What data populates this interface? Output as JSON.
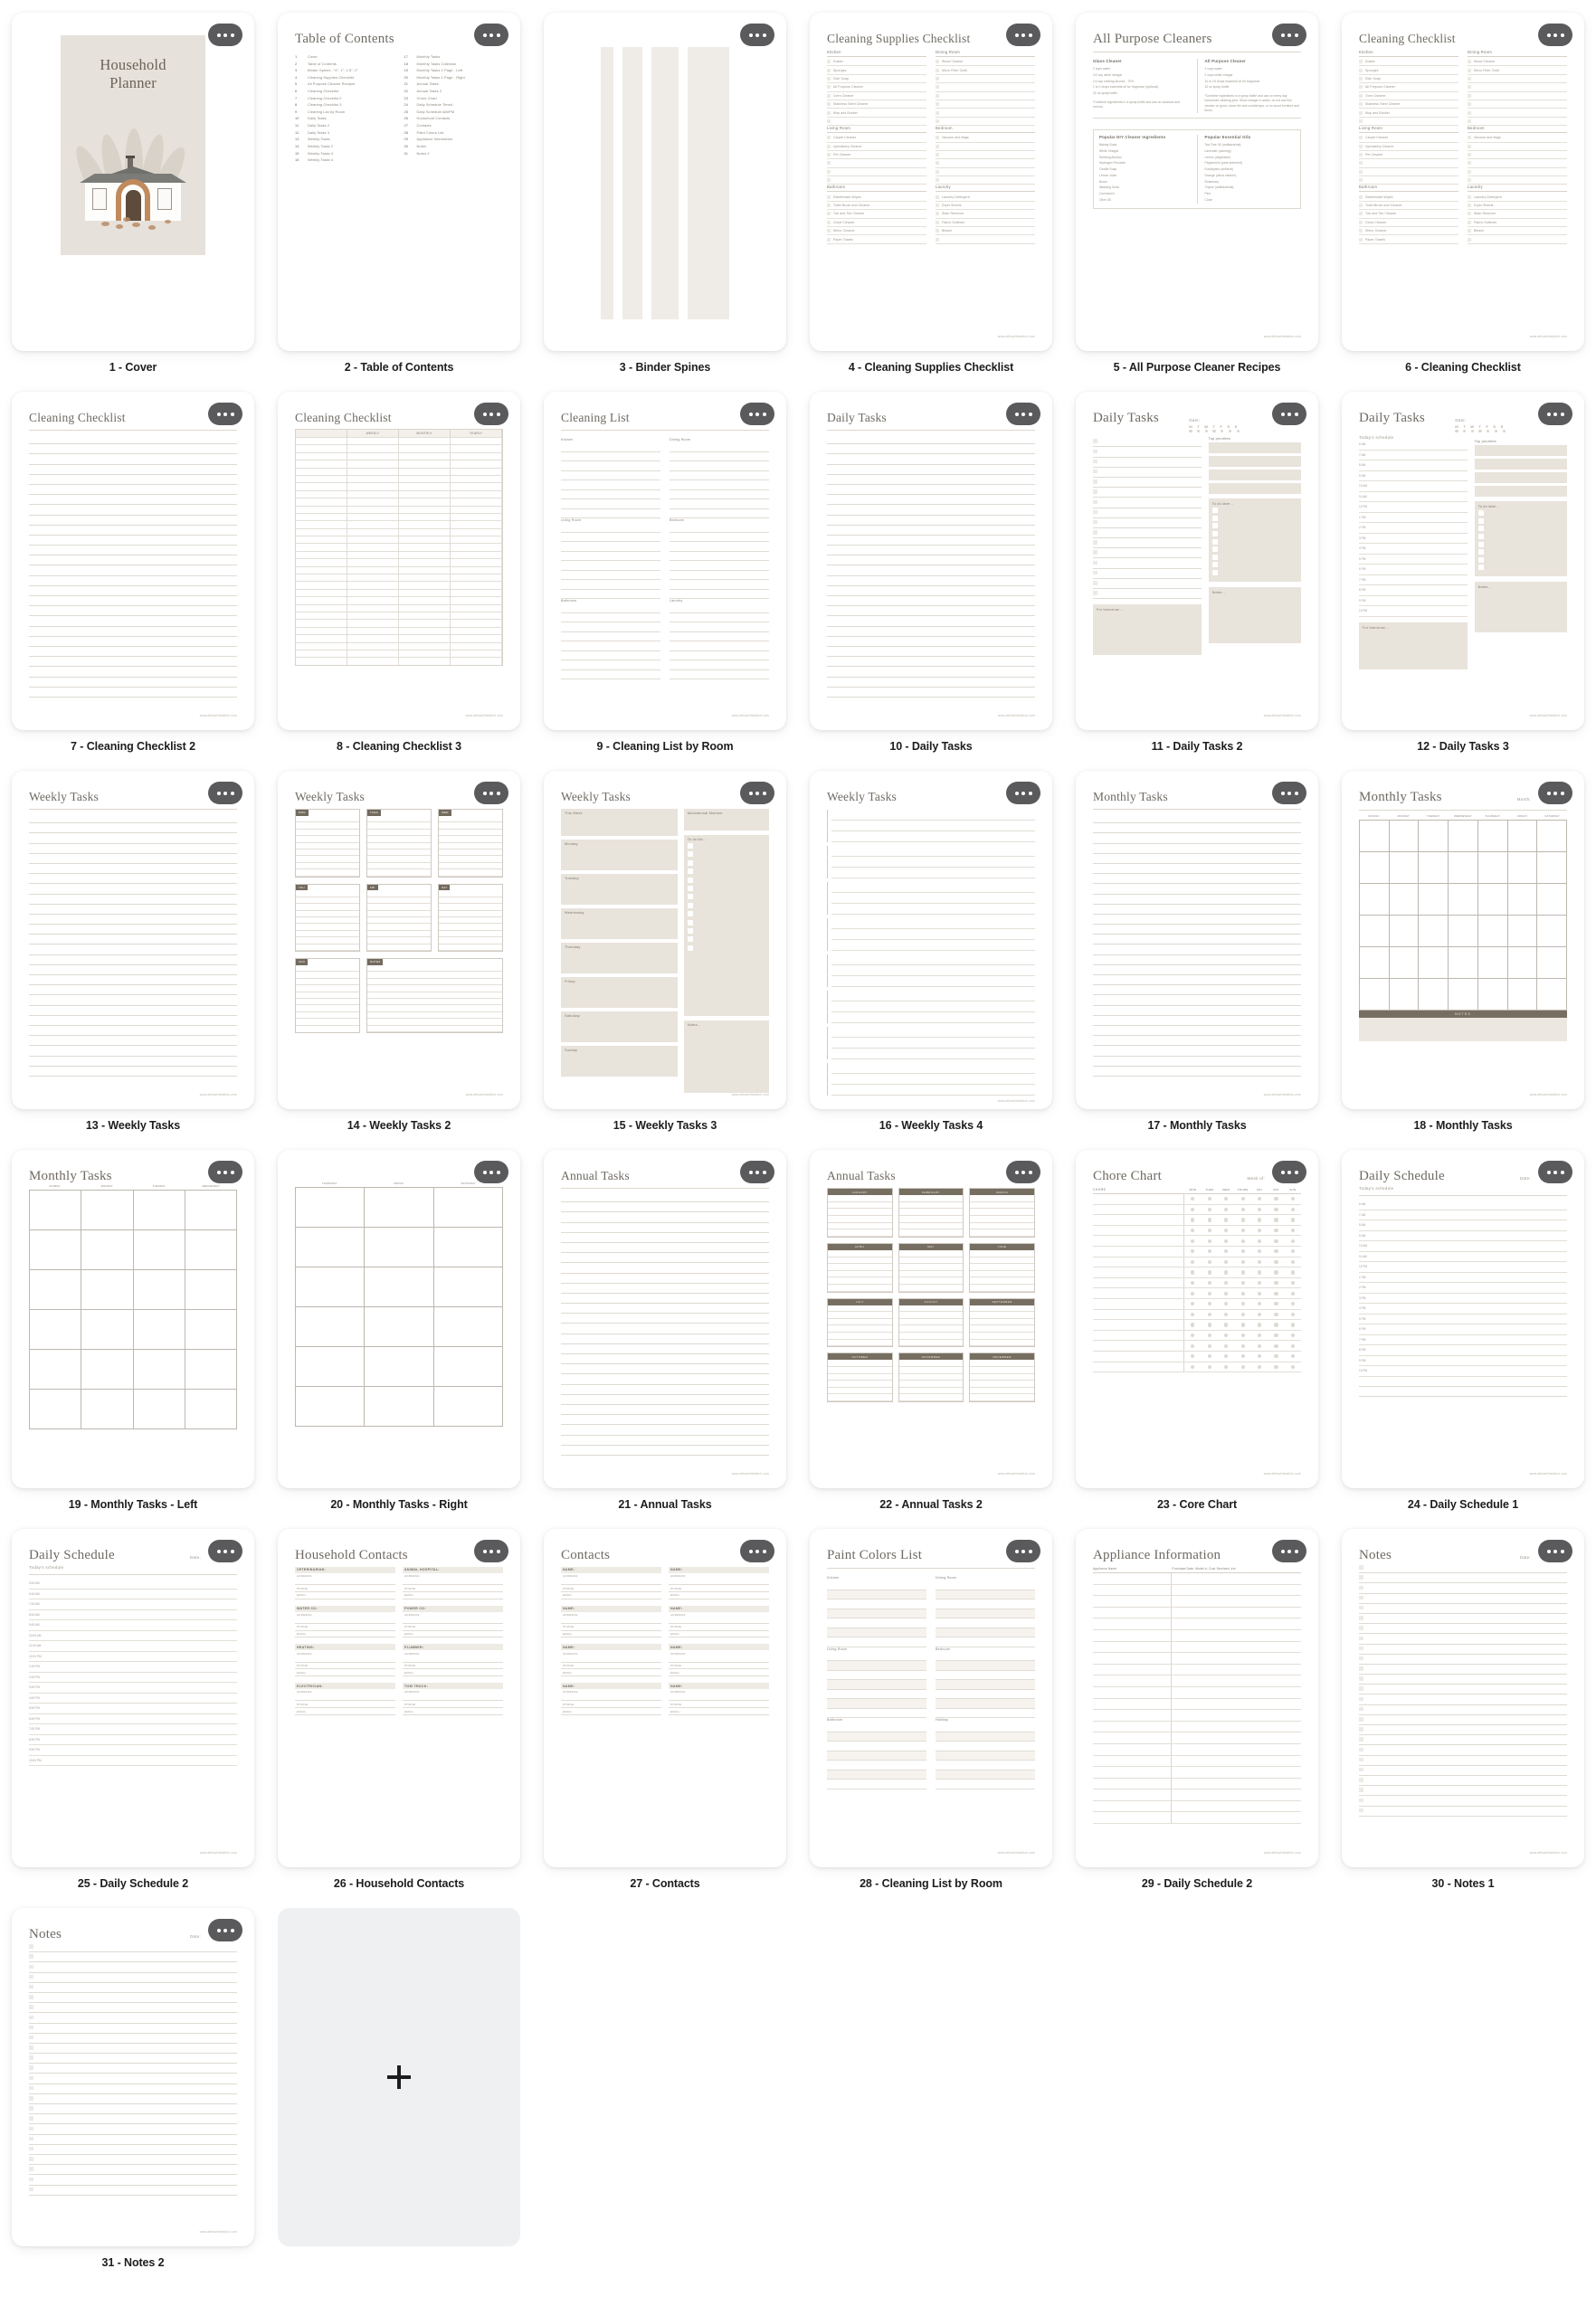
{
  "app": {
    "background_color": "#ffffff",
    "card_background": "#ffffff",
    "accent_brown": "#776e62",
    "shade_beige": "#e8e3db",
    "dots_button_color": "#5a5a5c",
    "add_card_color": "#eef0f2",
    "add_icon": "plus-icon",
    "menu_icon": "ellipsis-icon"
  },
  "pages": [
    {
      "num": "1",
      "caption": "1 - Cover",
      "title": "Household Planner",
      "kind": "cover"
    },
    {
      "num": "2",
      "caption": "2 - Table of Contents",
      "title": "Table of Contents",
      "kind": "toc"
    },
    {
      "num": "3",
      "caption": "3 - Binder Spines",
      "title": "Binder Spines",
      "kind": "spines"
    },
    {
      "num": "4",
      "caption": "4 - Cleaning Supplies Checklist",
      "title": "Cleaning Supplies Checklist",
      "kind": "supplies"
    },
    {
      "num": "5",
      "caption": "5 - All Purpose Cleaner Recipes",
      "title": "All Purpose Cleaners",
      "kind": "recipes"
    },
    {
      "num": "6",
      "caption": "6 - Cleaning Checklist",
      "title": "Cleaning Checklist",
      "kind": "supplies"
    },
    {
      "num": "7",
      "caption": "7 - Cleaning Checklist 2",
      "title": "Cleaning Checklist",
      "kind": "plain-lines"
    },
    {
      "num": "8",
      "caption": "8 - Cleaning Checklist 3",
      "title": "Cleaning Checklist",
      "kind": "table"
    },
    {
      "num": "9",
      "caption": "9 - Cleaning List by Room",
      "title": "Cleaning List",
      "kind": "room-list"
    },
    {
      "num": "10",
      "caption": "10 - Daily Tasks",
      "title": "Daily Tasks",
      "kind": "plain-lines"
    },
    {
      "num": "11",
      "caption": "11 - Daily Tasks 2",
      "title": "Daily Tasks",
      "kind": "daily2"
    },
    {
      "num": "12",
      "caption": "12 - Daily Tasks 3",
      "title": "Daily Tasks",
      "kind": "daily3"
    },
    {
      "num": "13",
      "caption": "13 - Weekly Tasks",
      "title": "Weekly Tasks",
      "kind": "plain-lines"
    },
    {
      "num": "14",
      "caption": "14 - Weekly Tasks 2",
      "title": "Weekly Tasks",
      "kind": "weekly-boxes"
    },
    {
      "num": "15",
      "caption": "15 - Weekly Tasks 3",
      "title": "Weekly Tasks",
      "kind": "weekly3"
    },
    {
      "num": "16",
      "caption": "16 - Weekly Tasks 4",
      "title": "Weekly Tasks",
      "kind": "weekly4"
    },
    {
      "num": "17",
      "caption": "17 - Monthly Tasks",
      "title": "Monthly Tasks",
      "kind": "plain-lines"
    },
    {
      "num": "18",
      "caption": "18 - Monthly Tasks",
      "title": "Monthly Tasks",
      "kind": "calendar"
    },
    {
      "num": "19",
      "caption": "19 - Monthly Tasks - Left",
      "title": "Monthly Tasks",
      "kind": "cal-left"
    },
    {
      "num": "20",
      "caption": "20 - Monthly Tasks - Right",
      "title": "",
      "kind": "cal-right"
    },
    {
      "num": "21",
      "caption": "21 - Annual Tasks",
      "title": "Annual Tasks",
      "kind": "plain-lines"
    },
    {
      "num": "22",
      "caption": "22 - Annual Tasks 2",
      "title": "Annual Tasks",
      "kind": "months"
    },
    {
      "num": "23",
      "caption": "23 - Core Chart",
      "title": "Chore Chart",
      "kind": "chore"
    },
    {
      "num": "24",
      "caption": "24 - Daily Schedule 1",
      "title": "Daily Schedule",
      "kind": "sched-timed"
    },
    {
      "num": "25",
      "caption": "25 - Daily Schedule 2",
      "title": "Daily Schedule",
      "kind": "sched-ampm"
    },
    {
      "num": "26",
      "caption": "26 - Household Contacts",
      "title": "Household Contacts",
      "kind": "contacts-house"
    },
    {
      "num": "27",
      "caption": "27 - Contacts",
      "title": "Contacts",
      "kind": "contacts-plain"
    },
    {
      "num": "28",
      "caption": "28 - Cleaning List by Room",
      "title": "Paint Colors List",
      "kind": "paint"
    },
    {
      "num": "29",
      "caption": "29 - Daily Schedule 2",
      "title": "Appliance Information",
      "kind": "appliance"
    },
    {
      "num": "30",
      "caption": "30 - Notes 1",
      "title": "Notes",
      "kind": "notes"
    },
    {
      "num": "31",
      "caption": "31 - Notes 2",
      "title": "Notes",
      "kind": "notes"
    }
  ],
  "toc": {
    "heading": "Table of Contents",
    "left": [
      {
        "n": "1",
        "t": "Cover"
      },
      {
        "n": "2",
        "t": "Table of Contents"
      },
      {
        "n": "3",
        "t": "Binder Spines - ½\", 1\", 1.5\", 2\""
      },
      {
        "n": "4",
        "t": "Cleaning Supplies Checklist"
      },
      {
        "n": "5",
        "t": "All Purpose Cleaner Recipes"
      },
      {
        "n": "6",
        "t": "Cleaning Checklist"
      },
      {
        "n": "7",
        "t": "Cleaning Checklist 2"
      },
      {
        "n": "8",
        "t": "Cleaning Checklist 3"
      },
      {
        "n": "9",
        "t": "Cleaning List by Room"
      },
      {
        "n": "10",
        "t": "Daily Tasks"
      },
      {
        "n": "11",
        "t": "Daily Tasks 2"
      },
      {
        "n": "12",
        "t": "Daily Tasks 3"
      },
      {
        "n": "13",
        "t": "Weekly Tasks"
      },
      {
        "n": "14",
        "t": "Weekly Tasks 2"
      },
      {
        "n": "15",
        "t": "Weekly Tasks 3"
      },
      {
        "n": "16",
        "t": "Weekly Tasks 4"
      }
    ],
    "right": [
      {
        "n": "17",
        "t": "Monthly Tasks"
      },
      {
        "n": "18",
        "t": "Monthly Tasks Calendar"
      },
      {
        "n": "19",
        "t": "Monthly Tasks 2 Page - Left"
      },
      {
        "n": "20",
        "t": "Monthly Tasks 2 Page - Right"
      },
      {
        "n": "21",
        "t": "Annual Tasks"
      },
      {
        "n": "22",
        "t": "Annual Tasks 2"
      },
      {
        "n": "23",
        "t": "Chore Chart"
      },
      {
        "n": "24",
        "t": "Daily Schedule Timed"
      },
      {
        "n": "25",
        "t": "Daily Schedule AM/PM"
      },
      {
        "n": "26",
        "t": "Household Contacts"
      },
      {
        "n": "27",
        "t": "Contacts"
      },
      {
        "n": "28",
        "t": "Paint Colors List"
      },
      {
        "n": "29",
        "t": "Appliance Information"
      },
      {
        "n": "30",
        "t": "Notes"
      },
      {
        "n": "31",
        "t": "Notes 2"
      }
    ]
  },
  "supplies": {
    "heading": "Cleaning Supplies Checklist",
    "col1_sections": [
      {
        "name": "Kitchen",
        "items": [
          "Duster",
          "Sponges",
          "Dish Soap",
          "All Purpose Cleaner",
          "Oven Cleaner",
          "Stainless Steel Cleaner",
          "Mop and Bucket",
          ""
        ]
      },
      {
        "name": "Living Room",
        "items": [
          "Carpet Cleaner",
          "Upholstery Cleaner",
          "Pet Cleaner",
          "",
          "",
          ""
        ]
      },
      {
        "name": "Bathroom",
        "items": [
          "Disinfectant Wipes",
          "Toilet Brush and Cleaner",
          "Tub and Tile Cleaner",
          "Grout Cleaner",
          "Mirror Cleaner",
          "Paper Towels"
        ]
      }
    ],
    "col2_sections": [
      {
        "name": "Dining Room",
        "items": [
          "Wood Cleaner",
          "Micro Fiber Cloth",
          "",
          "",
          "",
          "",
          "",
          ""
        ]
      },
      {
        "name": "Bedroom",
        "items": [
          "Vacuum and Bags",
          "",
          "",
          "",
          "",
          ""
        ]
      },
      {
        "name": "Laundry",
        "items": [
          "Laundry Detergent",
          "Dryer Sheets",
          "Stain Remover",
          "Fabric Softener",
          "Bleach",
          ""
        ]
      }
    ]
  },
  "recipes": {
    "heading": "All Purpose Cleaners",
    "top": [
      {
        "name": "Glass Cleaner",
        "lines": [
          "2 cups water",
          "1/2 cup white vinegar",
          "1/4 cup rubbing alcohol - 70%",
          "1 to 2 drops essential oil for fragrance (optional)",
          "32 oz spray bottle"
        ],
        "note": "*Combine ingredients in a spray bottle and use on windows and mirrors."
      },
      {
        "name": "All Purpose Cleaner",
        "lines": [
          "2 cups water",
          "2 cups white vinegar",
          "10 to 15 drops essential oil for fragrance",
          "32 oz spray bottle"
        ],
        "note": "*Combine ingredients in a spray bottle and use on every day household cleaning jobs. Since vinegar is acidic, do not use this cleaner on grout, stone tile and countertops, or on wood furniture and floors."
      }
    ],
    "bottom": [
      {
        "name": "Popular DIY Cleaner Ingredients",
        "lines": [
          "Baking Soda",
          "White Vinegar",
          "Rubbing Alcohol",
          "Hydrogen Peroxide",
          "Castile Soap",
          "Lemon Juice",
          "Borax",
          "Washing Soda",
          "Cornstarch",
          "Olive Oil"
        ]
      },
      {
        "name": "Popular Essential Oils",
        "lines": [
          "Tea Tree Oil (antibacterial)",
          "Lavender (calming)",
          "Lemon (degreaser)",
          "Peppermint (pest deterrent)",
          "Eucalyptus (antiviral)",
          "Orange (citrus cleaner)",
          "Rosemary",
          "Thyme (antibacterial)",
          "Pine",
          "Clove"
        ]
      }
    ]
  },
  "room_list": {
    "heading": "Cleaning List",
    "col1": [
      "Kitchen",
      "Living Room",
      "Bathroom"
    ],
    "col2": [
      "Dining Room",
      "Bedroom",
      "Laundry"
    ]
  },
  "daily": {
    "heading": "Daily Tasks",
    "date_label": "Date:",
    "days": [
      "M",
      "T",
      "W",
      "T",
      "F",
      "S",
      "S"
    ],
    "top_priorities_label": "Top priorities",
    "todo_later_label": "To do later...",
    "notes_label": "Notes...",
    "tomorrow_label": "For tomorrow ...",
    "today_label": "Today's schedule"
  },
  "weekly": {
    "heading": "Weekly Tasks",
    "boxes": [
      "MON",
      "TUES",
      "WED",
      "THU",
      "FRI",
      "SAT",
      "SUN",
      "NOTES"
    ],
    "this_week_label": "This Week",
    "motivation_label": "Motivational Moment",
    "day_rows": [
      "Monday",
      "Tuesday",
      "Wednesday",
      "Thursday",
      "Friday",
      "Saturday",
      "Sunday"
    ],
    "todo_label": "To do list...",
    "notes_label": "Notes..."
  },
  "monthly": {
    "heading": "Monthly Tasks",
    "month_label": "Month:",
    "weekdays": [
      "SUNDAY",
      "MONDAY",
      "TUESDAY",
      "WEDNESDAY",
      "THURSDAY",
      "FRIDAY",
      "SATURDAY"
    ],
    "notes_bar": "NOTES"
  },
  "annual": {
    "heading": "Annual Tasks",
    "months": [
      "JANUARY",
      "FEBRUARY",
      "MARCH",
      "APRIL",
      "MAY",
      "JUNE",
      "JULY",
      "AUGUST",
      "SEPTEMBER",
      "OCTOBER",
      "NOVEMBER",
      "DECEMBER"
    ]
  },
  "chore": {
    "heading": "Chore Chart",
    "week_label": "Week of:",
    "chore_col": "CHORE",
    "days": [
      "MON",
      "TUES",
      "WED",
      "THURS",
      "FRI",
      "SAT",
      "SUN"
    ],
    "rows": 17
  },
  "schedule": {
    "heading": "Daily Schedule",
    "date_label": "Date:",
    "today_label": "Today's schedule",
    "timed": [
      "6 AM",
      "7 AM",
      "8 AM",
      "9 AM",
      "10 AM",
      "11 AM",
      "12 PM",
      "1 PM",
      "2 PM",
      "3 PM",
      "4 PM",
      "5 PM",
      "6 PM",
      "7 PM",
      "8 PM",
      "9 PM",
      "10 PM"
    ],
    "ampm": [
      "5:00 AM",
      "6:00 AM",
      "7:00 AM",
      "8:00 AM",
      "9:00 AM",
      "10:00 AM",
      "11:00 AM",
      "12:00 PM",
      "1:00 PM",
      "2:00 PM",
      "3:00 PM",
      "4:00 PM",
      "5:00 PM",
      "6:00 PM",
      "7:00 PM",
      "8:00 PM",
      "9:00 PM",
      "10:00 PM"
    ]
  },
  "contacts": {
    "heading": "Household Contacts",
    "plain_heading": "Contacts",
    "address_label": "ADDRESS:",
    "phone_label": "PHONE:",
    "email_label": "EMAIL:",
    "name_label": "NAME:",
    "entries": [
      "VETERINARIAN:",
      "ANIMAL HOSPITAL:",
      "WATER CO:",
      "POWER CO:",
      "HEATING:",
      "PLUMBER:",
      "ELECTRICIAN:",
      "TOW TRUCK:"
    ]
  },
  "paint": {
    "heading": "Paint Colors List",
    "col1": [
      "Kitchen",
      "Living Room",
      "Bathroom"
    ],
    "col2": [
      "Dining Room",
      "Bedroom",
      "Hallway"
    ]
  },
  "appliance": {
    "heading": "Appliance Information",
    "columns": [
      "Appliance Name",
      "Purchase Date, Model #, Cost Serviced, etc."
    ]
  },
  "notes": {
    "heading": "Notes",
    "date_label": "Date:"
  },
  "footer_url": "www.withoutthestitch.com",
  "add_card": {
    "label": "+",
    "name": "add-page-button"
  }
}
